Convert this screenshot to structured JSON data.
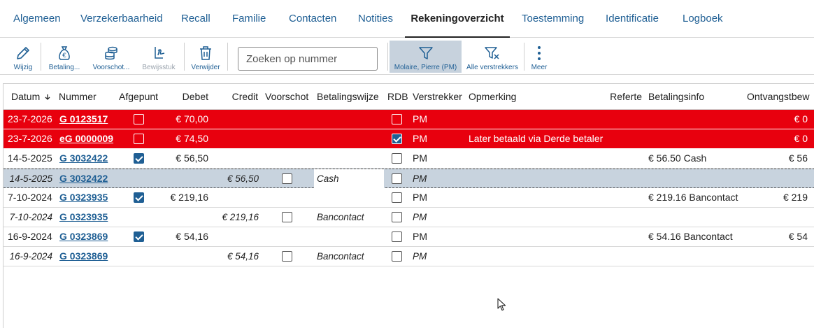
{
  "tabs": [
    {
      "label": "Algemeen",
      "active": false
    },
    {
      "label": "Verzekerbaarheid",
      "active": false
    },
    {
      "label": "Recall",
      "active": false
    },
    {
      "label": "Familie",
      "active": false
    },
    {
      "label": "Contacten",
      "active": false
    },
    {
      "label": "Notities",
      "active": false
    },
    {
      "label": "Rekeningoverzicht",
      "active": true
    },
    {
      "label": "Toestemming",
      "active": false
    },
    {
      "label": "Identificatie",
      "active": false
    },
    {
      "label": "Logboek",
      "active": false
    }
  ],
  "toolbar": {
    "edit_label": "Wijzig",
    "payment_label": "Betaling...",
    "advance_label": "Voorschot...",
    "receipt_label": "Bewijsstuk",
    "delete_label": "Verwijder",
    "search_placeholder": "Zoeken op nummer",
    "filter_provider_label": "Molaire, Pierre (PM)",
    "all_providers_label": "Alle verstrekkers",
    "more_label": "Meer"
  },
  "table": {
    "columns": {
      "datum": "Datum",
      "nummer": "Nummer",
      "afgepunt": "Afgepunt",
      "debet": "Debet",
      "credit": "Credit",
      "voorschot": "Voorschot",
      "betalingswijze": "Betalingswijze",
      "rdb": "RDB",
      "verstrekker": "Verstrekker",
      "opmerking": "Opmerking",
      "referte": "Referte",
      "betalingsinfo": "Betalingsinfo",
      "ontvangst": "Ontvangstbew"
    },
    "rows": [
      {
        "style": "red",
        "datum": "23-7-2026",
        "nummer": "G 0123517",
        "afgepunt": false,
        "debet": "€ 70,00",
        "credit": "",
        "voorschot": null,
        "betalingswijze": "",
        "rdb": false,
        "verstrekker": "PM",
        "opmerking": "",
        "betalingsinfo": "",
        "ontvangst": "€ 0"
      },
      {
        "style": "red",
        "datum": "23-7-2026",
        "nummer": "eG 0000009",
        "afgepunt": false,
        "debet": "€ 74,50",
        "credit": "",
        "voorschot": null,
        "betalingswijze": "",
        "rdb": true,
        "verstrekker": "PM",
        "opmerking": "Later betaald via Derde betaler",
        "betalingsinfo": "",
        "ontvangst": "€ 0"
      },
      {
        "style": "main",
        "datum": "14-5-2025",
        "nummer": "G 3032422",
        "afgepunt": true,
        "debet": "€ 56,50",
        "credit": "",
        "voorschot": null,
        "betalingswijze": "",
        "rdb": false,
        "verstrekker": "PM",
        "opmerking": "",
        "betalingsinfo": "€ 56.50 Cash",
        "ontvangst": "€ 56"
      },
      {
        "style": "sel",
        "datum": "14-5-2025",
        "nummer": "G 3032422",
        "afgepunt": null,
        "debet": "",
        "credit": "€ 56,50",
        "voorschot": false,
        "betalingswijze": "Cash",
        "rdb": false,
        "verstrekker": "PM",
        "opmerking": "",
        "betalingsinfo": "",
        "ontvangst": ""
      },
      {
        "style": "main",
        "datum": "7-10-2024",
        "nummer": "G 0323935",
        "afgepunt": true,
        "debet": "€ 219,16",
        "credit": "",
        "voorschot": null,
        "betalingswijze": "",
        "rdb": false,
        "verstrekker": "PM",
        "opmerking": "",
        "betalingsinfo": "€ 219.16 Bancontact",
        "ontvangst": "€ 219"
      },
      {
        "style": "sub",
        "datum": "7-10-2024",
        "nummer": "G 0323935",
        "afgepunt": null,
        "debet": "",
        "credit": "€ 219,16",
        "voorschot": false,
        "betalingswijze": "Bancontact",
        "rdb": false,
        "verstrekker": "PM",
        "opmerking": "",
        "betalingsinfo": "",
        "ontvangst": ""
      },
      {
        "style": "main",
        "datum": "16-9-2024",
        "nummer": "G 0323869",
        "afgepunt": true,
        "debet": "€ 54,16",
        "credit": "",
        "voorschot": null,
        "betalingswijze": "",
        "rdb": false,
        "verstrekker": "PM",
        "opmerking": "",
        "betalingsinfo": "€ 54.16 Bancontact",
        "ontvangst": "€ 54"
      },
      {
        "style": "sub",
        "datum": "16-9-2024",
        "nummer": "G 0323869",
        "afgepunt": null,
        "debet": "",
        "credit": "€ 54,16",
        "voorschot": false,
        "betalingswijze": "Bancontact",
        "rdb": false,
        "verstrekker": "PM",
        "opmerking": "",
        "betalingsinfo": "",
        "ontvangst": ""
      }
    ]
  },
  "icons": {
    "edit": "pencil-icon",
    "payment": "money-bag-icon",
    "advance": "coin-stack-icon",
    "receipt": "receipt-signature-icon",
    "delete": "trash-icon",
    "filter": "filter-icon",
    "clear_filter": "filter-clear-icon",
    "more": "vertical-dots-icon",
    "sort": "sort-down-arrow-icon"
  },
  "colors": {
    "accent": "#1f5f94",
    "warning_row": "#e8000e",
    "selected_row": "#c8d3de"
  }
}
